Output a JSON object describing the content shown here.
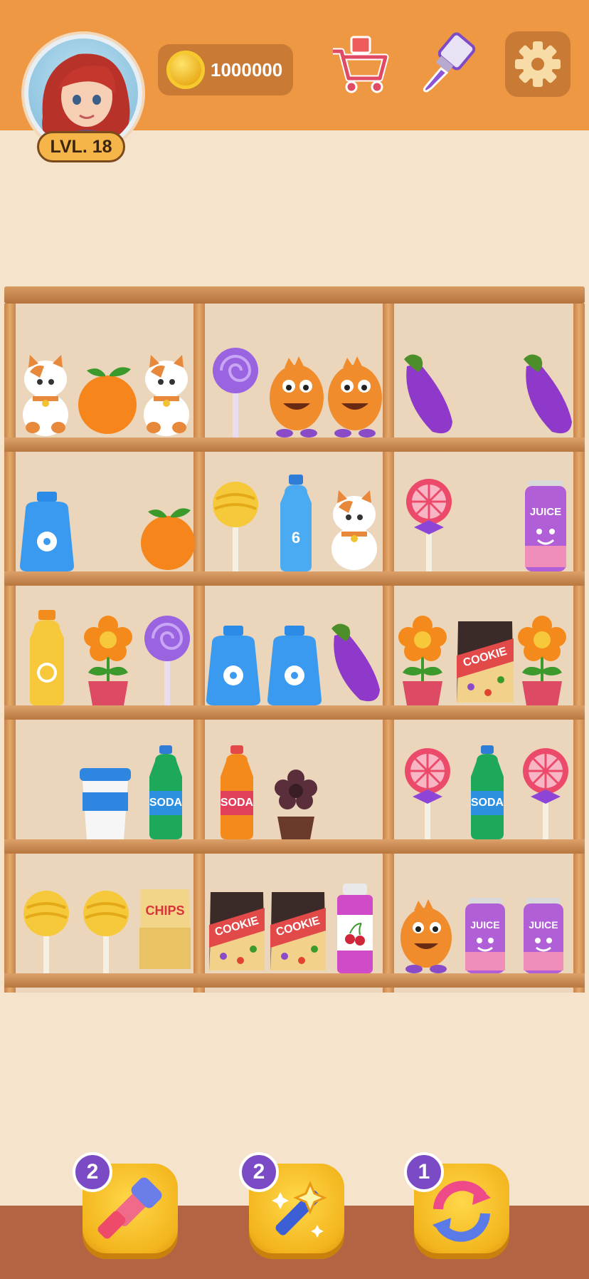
{
  "header": {
    "level_label": "LVL. 18",
    "coins": "1000000"
  },
  "icons": {
    "shop": "cart-icon",
    "theme": "paint-brush-icon",
    "settings": "gear-icon"
  },
  "shelf_labels": {
    "juice": "JUICE",
    "soda": "SODA",
    "cookie": "COOKIE",
    "chips": "CHIPS"
  },
  "boosters": [
    {
      "name": "hammer",
      "count": "2"
    },
    {
      "name": "magic-wand",
      "count": "2"
    },
    {
      "name": "shuffle",
      "count": "1"
    }
  ]
}
